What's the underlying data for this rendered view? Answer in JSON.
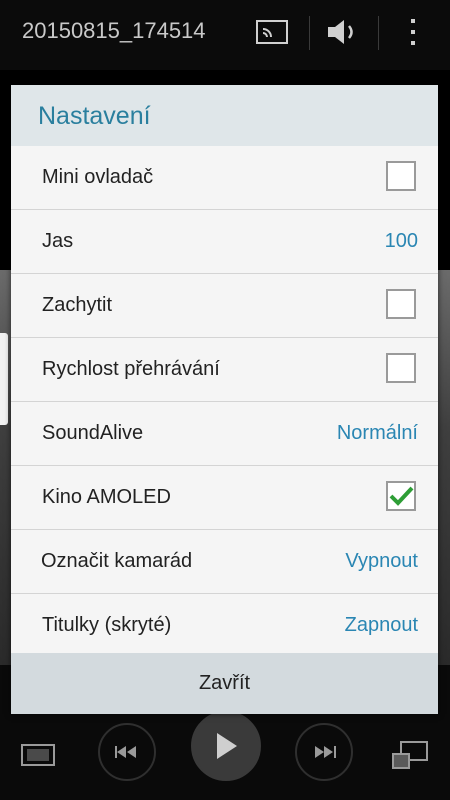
{
  "player": {
    "file_title": "20150815_174514",
    "icons": {
      "cast": "screen-mirror-icon",
      "volume": "volume-icon",
      "more": "more-vert-icon"
    }
  },
  "dialog": {
    "title": "Nastavení",
    "rows": [
      {
        "label": "Mini ovladač",
        "type": "checkbox",
        "checked": false
      },
      {
        "label": "Jas",
        "type": "value",
        "value": "100"
      },
      {
        "label": "Zachytit",
        "type": "checkbox",
        "checked": false
      },
      {
        "label": "Rychlost přehrávání",
        "type": "checkbox",
        "checked": false
      },
      {
        "label": "SoundAlive",
        "type": "value",
        "value": "Normální"
      },
      {
        "label": "Kino AMOLED",
        "type": "checkbox",
        "checked": true
      },
      {
        "label": "Označit kamarád",
        "type": "value",
        "value": "Vypnout"
      },
      {
        "label": "Titulky (skryté)",
        "type": "value",
        "value": "Zapnout"
      }
    ],
    "close_label": "Zavřít"
  },
  "colors": {
    "accent": "#2a86b3",
    "check": "#2e9e36",
    "header_bg": "#dfe6e9"
  }
}
